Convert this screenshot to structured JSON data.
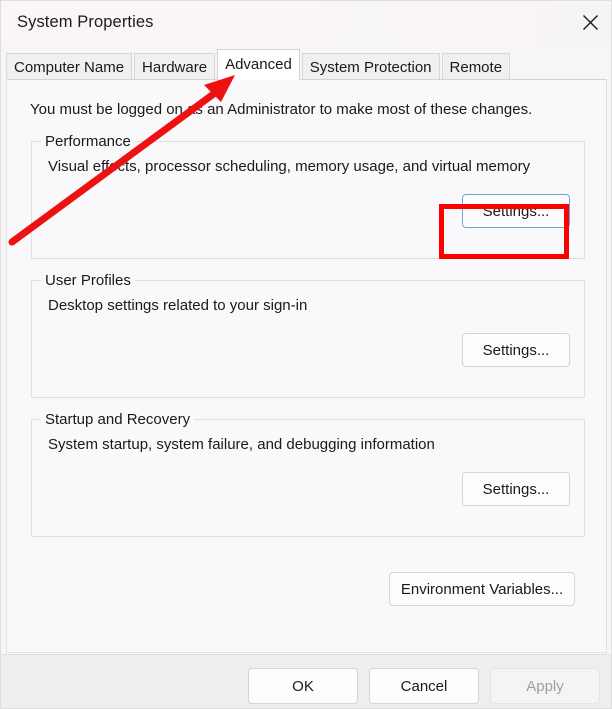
{
  "window": {
    "title": "System Properties",
    "close_icon": "close-icon"
  },
  "tabs": [
    {
      "label": "Computer Name",
      "selected": false
    },
    {
      "label": "Hardware",
      "selected": false
    },
    {
      "label": "Advanced",
      "selected": true
    },
    {
      "label": "System Protection",
      "selected": false
    },
    {
      "label": "Remote",
      "selected": false
    }
  ],
  "main": {
    "admin_note": "You must be logged on as an Administrator to make most of these changes.",
    "groups": [
      {
        "legend": "Performance",
        "description": "Visual effects, processor scheduling, memory usage, and virtual memory",
        "button_label": "Settings..."
      },
      {
        "legend": "User Profiles",
        "description": "Desktop settings related to your sign-in",
        "button_label": "Settings..."
      },
      {
        "legend": "Startup and Recovery",
        "description": "System startup, system failure, and debugging information",
        "button_label": "Settings..."
      }
    ],
    "environment_variables_label": "Environment Variables..."
  },
  "footer": {
    "ok_label": "OK",
    "cancel_label": "Cancel",
    "apply_label": "Apply"
  },
  "annotations": {
    "arrow_color": "#ee1111",
    "highlight_color": "#ff0000"
  }
}
